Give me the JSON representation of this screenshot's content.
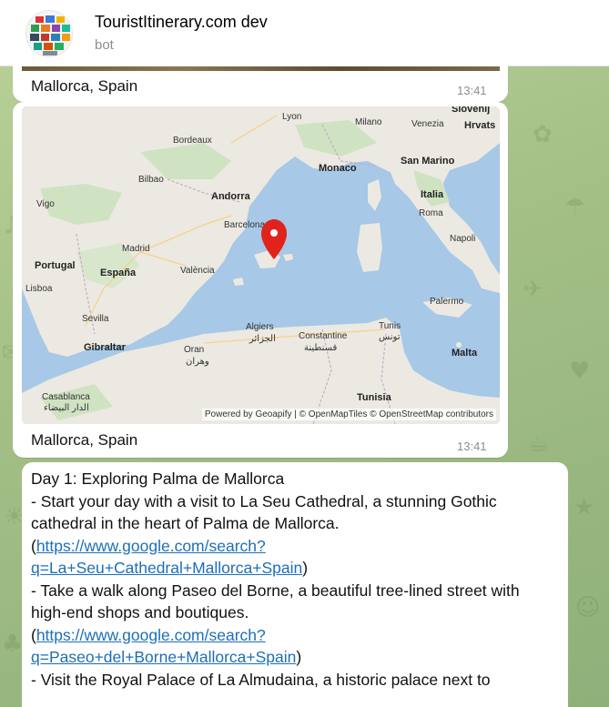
{
  "header": {
    "title": "TouristItinerary.com dev",
    "subtitle": "bot"
  },
  "messages": {
    "photo_caption": "Mallorca, Spain",
    "photo_time": "13:41",
    "map_caption": "Mallorca, Spain",
    "map_time": "13:41",
    "map_attribution": "Powered by Geoapify | © OpenMapTiles © OpenStreetMap contributors"
  },
  "map": {
    "labels": {
      "lyon": "Lyon",
      "milano": "Milano",
      "venezia": "Venezia",
      "slovenij": "Slovenij",
      "hrvats": "Hrvats",
      "bordeaux": "Bordeaux",
      "monaco": "Monaco",
      "san_marino": "San Marino",
      "bilbao": "Bilbao",
      "andorra": "Andorra",
      "italia": "Italia",
      "vigo": "Vigo",
      "roma": "Roma",
      "barcelona": "Barcelona",
      "napoli": "Napoli",
      "madrid": "Madrid",
      "portugal": "Portugal",
      "espana": "España",
      "valencia": "València",
      "lisboa": "Lisboa",
      "palermo": "Palermo",
      "sevilla": "Sevilla",
      "algiers": "Algiers",
      "algiers_ar": "الجزائر",
      "constantine": "Constantine",
      "constantine_ar": "قسنطينة",
      "tunis": "Tunis",
      "tunis_ar": "تونس",
      "gibraltar": "Gibraltar",
      "oran": "Oran",
      "oran_ar": "وهران",
      "malta": "Malta",
      "casablanca": "Casablanca",
      "casablanca_ar": "الدار البيضاء",
      "tunisia": "Tunisia"
    },
    "colors": {
      "sea": "#a7c8e6",
      "land": "#ece9e2",
      "green": "#cfe3c2",
      "marker": "#e0241b"
    }
  },
  "itinerary": {
    "day_title": "Day 1: Exploring Palma de Mallorca",
    "item1_text": "- Start your day with a visit to La Seu Cathedral, a stunning Gothic cathedral in the heart of Palma de Mallorca.",
    "item1_link": "https://www.google.com/search?q=La+Seu+Cathedral+Mallorca+Spain",
    "item2_text": "- Take a walk along Paseo del Borne, a beautiful tree-lined street with high-end shops and boutiques.",
    "item2_link": "https://www.google.com/search?q=Paseo+del+Borne+Mallorca+Spain",
    "item3_text": "- Visit the Royal Palace of La Almudaina, a historic palace next to"
  }
}
